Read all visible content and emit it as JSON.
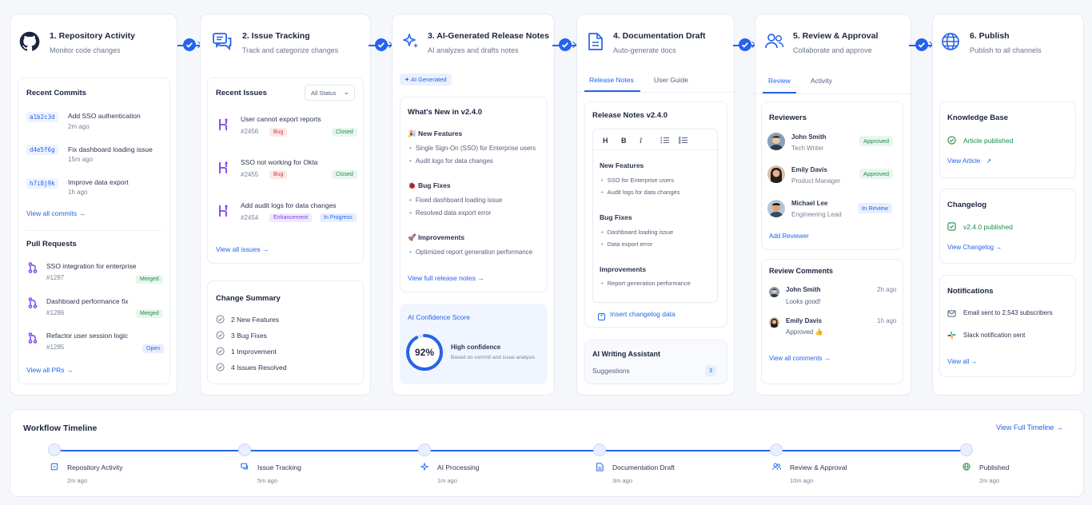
{
  "steps": [
    {
      "title": "1. Repository Activity",
      "subtitle": "Monitor code changes"
    },
    {
      "title": "2. Issue Tracking",
      "subtitle": "Track and categorize changes"
    },
    {
      "title": "3. AI-Generated Release Notes",
      "subtitle": "AI analyzes and drafts notes"
    },
    {
      "title": "4. Documentation Draft",
      "subtitle": "Auto-generate docs"
    },
    {
      "title": "5. Review & Approval",
      "subtitle": "Collaborate and approve"
    },
    {
      "title": "6. Publish",
      "subtitle": "Publish to all channels"
    }
  ],
  "repo": {
    "commits_title": "Recent Commits",
    "commits": [
      {
        "hash": "a1b2c3d",
        "message": "Add SSO authentication",
        "time": "2m ago"
      },
      {
        "hash": "d4e5f6g",
        "message": "Fix dashboard loading issue",
        "time": "15m ago"
      },
      {
        "hash": "h7i8j9k",
        "message": "Improve data export",
        "time": "1h ago"
      }
    ],
    "view_commits": "View all commits",
    "prs_title": "Pull Requests",
    "prs": [
      {
        "title": "SSO integration for enterprise",
        "number": "#1287",
        "status": "Merged"
      },
      {
        "title": "Dashboard performance fix",
        "number": "#1286",
        "status": "Merged"
      },
      {
        "title": "Refactor user session logic",
        "number": "#1285",
        "status": "Open"
      }
    ],
    "view_prs": "View all PRs"
  },
  "issues": {
    "title": "Recent Issues",
    "filter": "All Status",
    "items": [
      {
        "title": "User cannot export reports",
        "number": "#2456",
        "type": "Bug",
        "status": "Closed"
      },
      {
        "title": "SSO not working for Okta",
        "number": "#2455",
        "type": "Bug",
        "status": "Closed"
      },
      {
        "title": "Add audit logs for data changes",
        "number": "#2454",
        "type": "Enhancement",
        "status": "In Progress"
      }
    ],
    "view_all": "View all issues",
    "summary_title": "Change Summary",
    "summary": [
      "2 New Features",
      "3 Bug Fixes",
      "1 Improvement",
      "4 Issues Resolved"
    ]
  },
  "ai": {
    "badge": "✦ AI Generated",
    "notes_title": "What's New in v2.4.0",
    "sections": [
      {
        "title": "New Features",
        "emoji": "🎉",
        "items": [
          "Single Sign-On (SSO) for Enterprise users",
          "Audit logs for data changes"
        ]
      },
      {
        "title": "Bug Fixes",
        "emoji": "🐞",
        "items": [
          "Fixed dashboard loading issue",
          "Resolved data export error"
        ]
      },
      {
        "title": "Improvements",
        "emoji": "🚀",
        "items": [
          "Optimized report generation performance"
        ]
      }
    ],
    "view_full": "View full release notes",
    "confidence_title": "AI Confidence Score",
    "confidence_value": 92,
    "confidence_text": "92%",
    "confidence_label": "High confidence",
    "confidence_sub": "Based on commit and issue analysis"
  },
  "docs": {
    "tabs": [
      "Release Notes",
      "User Guide"
    ],
    "card_title": "Release Notes v2.4.0",
    "toolbar": [
      "H",
      "B",
      "I"
    ],
    "sections": [
      {
        "title": "New Features",
        "items": [
          "SSO for Enterprise users",
          "Audit logs for data changes"
        ]
      },
      {
        "title": "Bug Fixes",
        "items": [
          "Dashboard loading issue",
          "Data export error"
        ]
      },
      {
        "title": "Improvements",
        "items": [
          "Report generation performance"
        ]
      }
    ],
    "insert": "Insert changelog data",
    "assistant_title": "AI Writing Assistant",
    "suggestions_label": "Suggestions",
    "suggestions_count": "3"
  },
  "review": {
    "tabs": [
      "Review",
      "Activity"
    ],
    "reviewers_title": "Reviewers",
    "reviewers": [
      {
        "name": "John Smith",
        "role": "Tech Writer",
        "status": "Approved"
      },
      {
        "name": "Emily Davis",
        "role": "Product Manager",
        "status": "Approved"
      },
      {
        "name": "Michael Lee",
        "role": "Engineering Lead",
        "status": "In Review"
      }
    ],
    "add_reviewer": "Add Reviewer",
    "comments_title": "Review Comments",
    "comments": [
      {
        "name": "John Smith",
        "text": "Looks good!",
        "time": "2h ago"
      },
      {
        "name": "Emily Davis",
        "text": "Approved 👍",
        "time": "1h ago"
      }
    ],
    "view_comments": "View all comments"
  },
  "publish": {
    "kb_title": "Knowledge Base",
    "kb_status": "Article published",
    "kb_link": "View Article",
    "changelog_title": "Changelog",
    "changelog_status": "v2.4.0 published",
    "changelog_link": "View Changelog",
    "notif_title": "Notifications",
    "notif_email": "Email sent to 2,543 subscribers",
    "notif_slack": "Slack notification sent",
    "notif_link": "View all"
  },
  "timeline": {
    "title": "Workflow Timeline",
    "view_full": "View Full Timeline",
    "events": [
      {
        "label": "Repository Activity",
        "time": "2m ago"
      },
      {
        "label": "Issue Tracking",
        "time": "5m ago"
      },
      {
        "label": "AI Processing",
        "time": "1m ago"
      },
      {
        "label": "Documentation Draft",
        "time": "3m ago"
      },
      {
        "label": "Review & Approval",
        "time": "10m ago"
      },
      {
        "label": "Published",
        "time": "2m ago"
      }
    ]
  },
  "colors": {
    "accent": "#2563eb",
    "success": "#1f8a4c",
    "danger": "#d23b3b",
    "purple": "#7a3ff0"
  }
}
